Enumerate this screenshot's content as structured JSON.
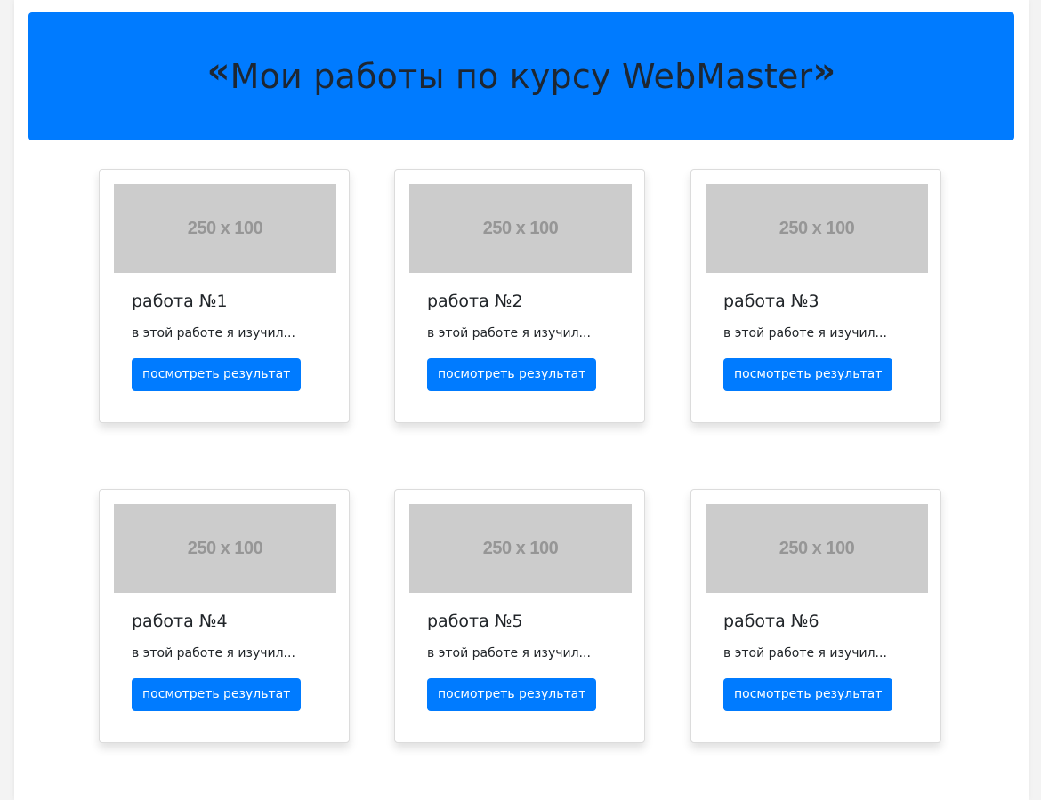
{
  "header": {
    "title": "Мои работы по курсу WebMaster",
    "quote_open": "«",
    "quote_close": "»"
  },
  "colors": {
    "primary": "#007bff",
    "placeholder_bg": "#cccccc",
    "placeholder_text": "#969696"
  },
  "cards": [
    {
      "image_label": "250 x 100",
      "title": "работа №1",
      "text": "в этой работе я изучил...",
      "button": "посмотреть результат"
    },
    {
      "image_label": "250 x 100",
      "title": "работа №2",
      "text": "в этой работе я изучил...",
      "button": "посмотреть результат"
    },
    {
      "image_label": "250 x 100",
      "title": "работа №3",
      "text": "в этой работе я изучил...",
      "button": "посмотреть результат"
    },
    {
      "image_label": "250 x 100",
      "title": "работа №4",
      "text": "в этой работе я изучил...",
      "button": "посмотреть результат"
    },
    {
      "image_label": "250 x 100",
      "title": "работа №5",
      "text": "в этой работе я изучил...",
      "button": "посмотреть результат"
    },
    {
      "image_label": "250 x 100",
      "title": "работа №6",
      "text": "в этой работе я изучил...",
      "button": "посмотреть результат"
    }
  ]
}
